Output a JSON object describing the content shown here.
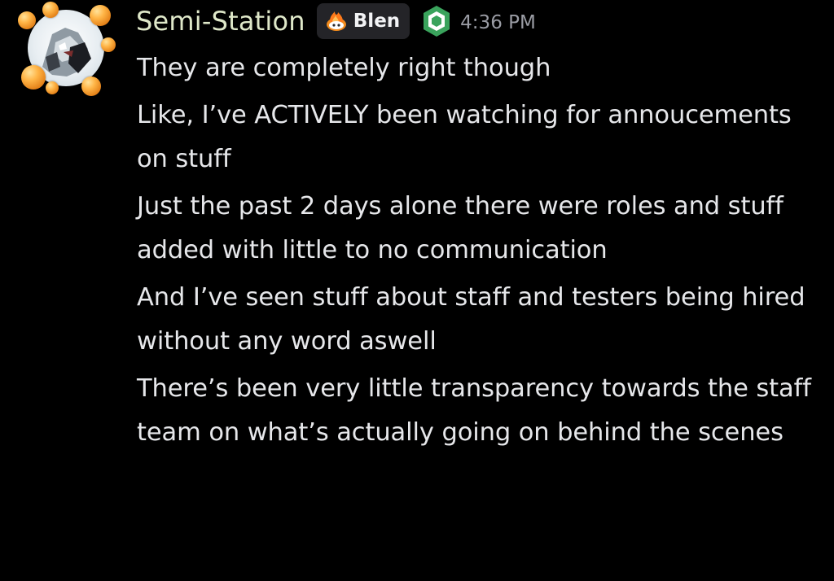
{
  "author": {
    "username": "Semi-Station",
    "username_color": "#dfe8c9",
    "avatar_icon": "avatar-icon",
    "guild_tag": {
      "icon": "flame-icon",
      "label": "Blen"
    },
    "role_icon": "shield-badge-icon",
    "timestamp": "4:36 PM"
  },
  "messages": [
    "They are completely right though",
    "Like, I’ve ACTIVELY been watching for annoucements on stuff",
    "Just the past 2 days alone there were roles and stuff added with little to no communication",
    "And I’ve seen stuff about staff and testers being hired without any word aswell",
    "There’s been very little transparency towards the staff team on what’s actually going on behind the scenes"
  ],
  "colors": {
    "background": "#000000",
    "message_text": "#e6e7ea",
    "timestamp": "#9a9ca4",
    "tag_background": "#242428",
    "role_icon": "#3aa35c"
  }
}
